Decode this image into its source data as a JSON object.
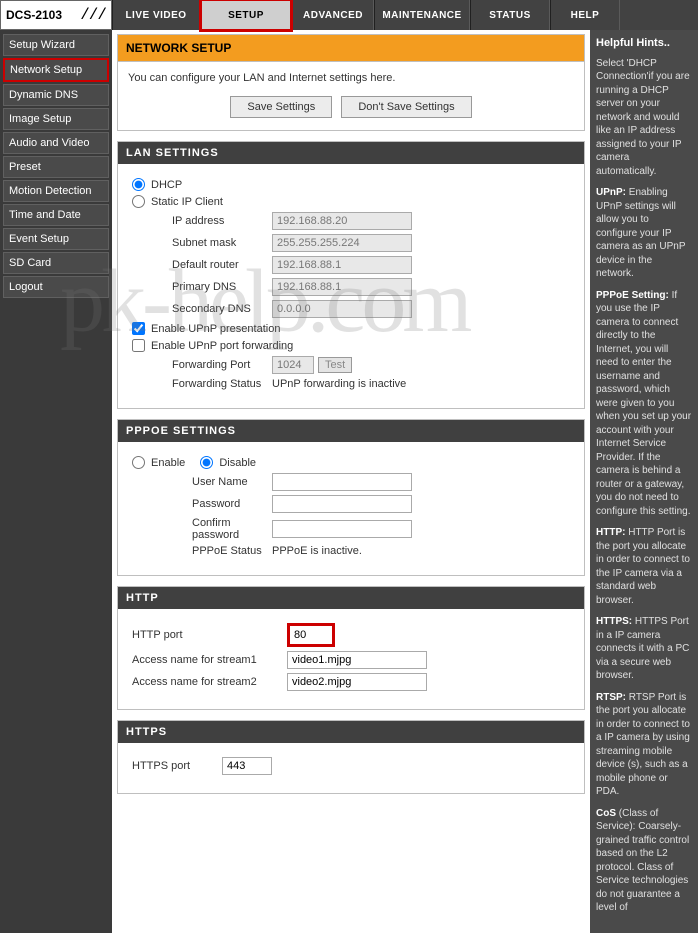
{
  "model": "DCS-2103",
  "topTabs": {
    "live": "LIVE VIDEO",
    "setup": "SETUP",
    "advanced": "ADVANCED",
    "maintenance": "MAINTENANCE",
    "status": "STATUS",
    "help": "HELP"
  },
  "sidebar": [
    "Setup Wizard",
    "Network Setup",
    "Dynamic DNS",
    "Image Setup",
    "Audio and Video",
    "Preset",
    "Motion Detection",
    "Time and Date",
    "Event Setup",
    "SD Card",
    "Logout"
  ],
  "page": {
    "title": "NETWORK SETUP",
    "intro": "You can configure your LAN and Internet settings here.",
    "saveBtn": "Save Settings",
    "dontSaveBtn": "Don't Save Settings"
  },
  "lan": {
    "title": "LAN SETTINGS",
    "dhcpLabel": "DHCP",
    "staticLabel": "Static IP Client",
    "ipLabel": "IP address",
    "ipValue": "192.168.88.20",
    "subnetLabel": "Subnet mask",
    "subnetValue": "255.255.255.224",
    "routerLabel": "Default router",
    "routerValue": "192.168.88.1",
    "pdnsLabel": "Primary DNS",
    "pdnsValue": "192.168.88.1",
    "sdnsLabel": "Secondary DNS",
    "sdnsValue": "0.0.0.0",
    "upnpPres": "Enable UPnP presentation",
    "upnpFwd": "Enable UPnP port forwarding",
    "fwdPortLabel": "Forwarding Port",
    "fwdPortValue": "1024",
    "testBtn": "Test",
    "fwdStatusLabel": "Forwarding Status",
    "fwdStatusValue": "UPnP forwarding is inactive"
  },
  "pppoe": {
    "title": "PPPOE SETTINGS",
    "enableLabel": "Enable",
    "disableLabel": "Disable",
    "userLabel": "User Name",
    "userValue": "",
    "pwdLabel": "Password",
    "pwdValue": "",
    "confirmLabel": "Confirm password",
    "confirmValue": "",
    "statusLabel": "PPPoE Status",
    "statusValue": "PPPoE is inactive."
  },
  "http": {
    "title": "HTTP",
    "portLabel": "HTTP port",
    "portValue": "80",
    "s1Label": "Access name for stream1",
    "s1Value": "video1.mjpg",
    "s2Label": "Access name for stream2",
    "s2Value": "video2.mjpg"
  },
  "https": {
    "title": "HTTPS",
    "portLabel": "HTTPS port",
    "portValue": "443"
  },
  "hints": {
    "title": "Helpful Hints..",
    "p1": "Select 'DHCP Connection'if you are running a DHCP server on your network and would like an IP address assigned to your IP camera automatically.",
    "p2": " Enabling UPnP settings will allow you to configure your IP camera as an UPnP device in the network.",
    "p2b": "UPnP:",
    "p3": " If you use the IP camera to connect directly to the Internet, you will need to enter the username and password, which were given to you when you set up your account with your Internet Service Provider. If the camera is behind a router or a gateway, you do not need to configure this setting.",
    "p3b": "PPPoE Setting:",
    "p4": " HTTP Port is the port you allocate in order to connect to the IP camera via a standard web browser.",
    "p4b": "HTTP:",
    "p5": " HTTPS Port in a IP camera connects it with a PC via a secure web browser.",
    "p5b": "HTTPS:",
    "p6": " RTSP Port is the port you allocate in order to connect to a IP camera by using streaming mobile device (s), such as a mobile phone or PDA.",
    "p6b": "RTSP:",
    "p7": " (Class of Service): Coarsely-grained traffic control based on the L2 protocol. Class of Service technologies do not guarantee a level of",
    "p7b": "CoS"
  },
  "watermark": "pk-help.com"
}
